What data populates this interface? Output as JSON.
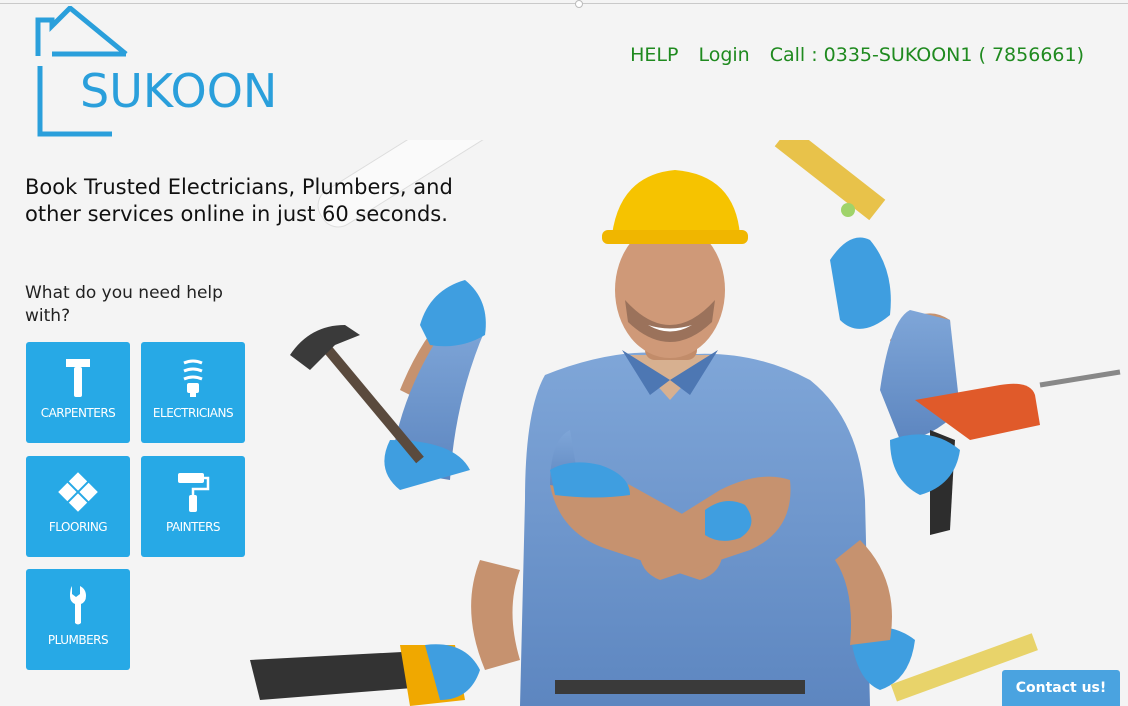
{
  "brand": {
    "name": "SUKOON",
    "color": "#2a9fdb"
  },
  "nav": {
    "help": "HELP",
    "login": "Login",
    "call": "Call : 0335-SUKOON1 ( 7856661)",
    "color": "#1f8a1f"
  },
  "hero": {
    "headline": "Book Trusted Electricians, Plumbers, and other services online in just 60 seconds.",
    "prompt": "What do you need help with?"
  },
  "services": [
    {
      "label": "CARPENTERS",
      "icon": "hammer-icon"
    },
    {
      "label": "ELECTRICIANS",
      "icon": "light-bulb-icon"
    },
    {
      "label": "FLOORING",
      "icon": "floor-tiles-icon"
    },
    {
      "label": "PAINTERS",
      "icon": "paint-roller-icon"
    },
    {
      "label": "PLUMBERS",
      "icon": "wrench-icon"
    }
  ],
  "tile_color": "#27a9e6",
  "contact": {
    "label": "Contact us!"
  }
}
